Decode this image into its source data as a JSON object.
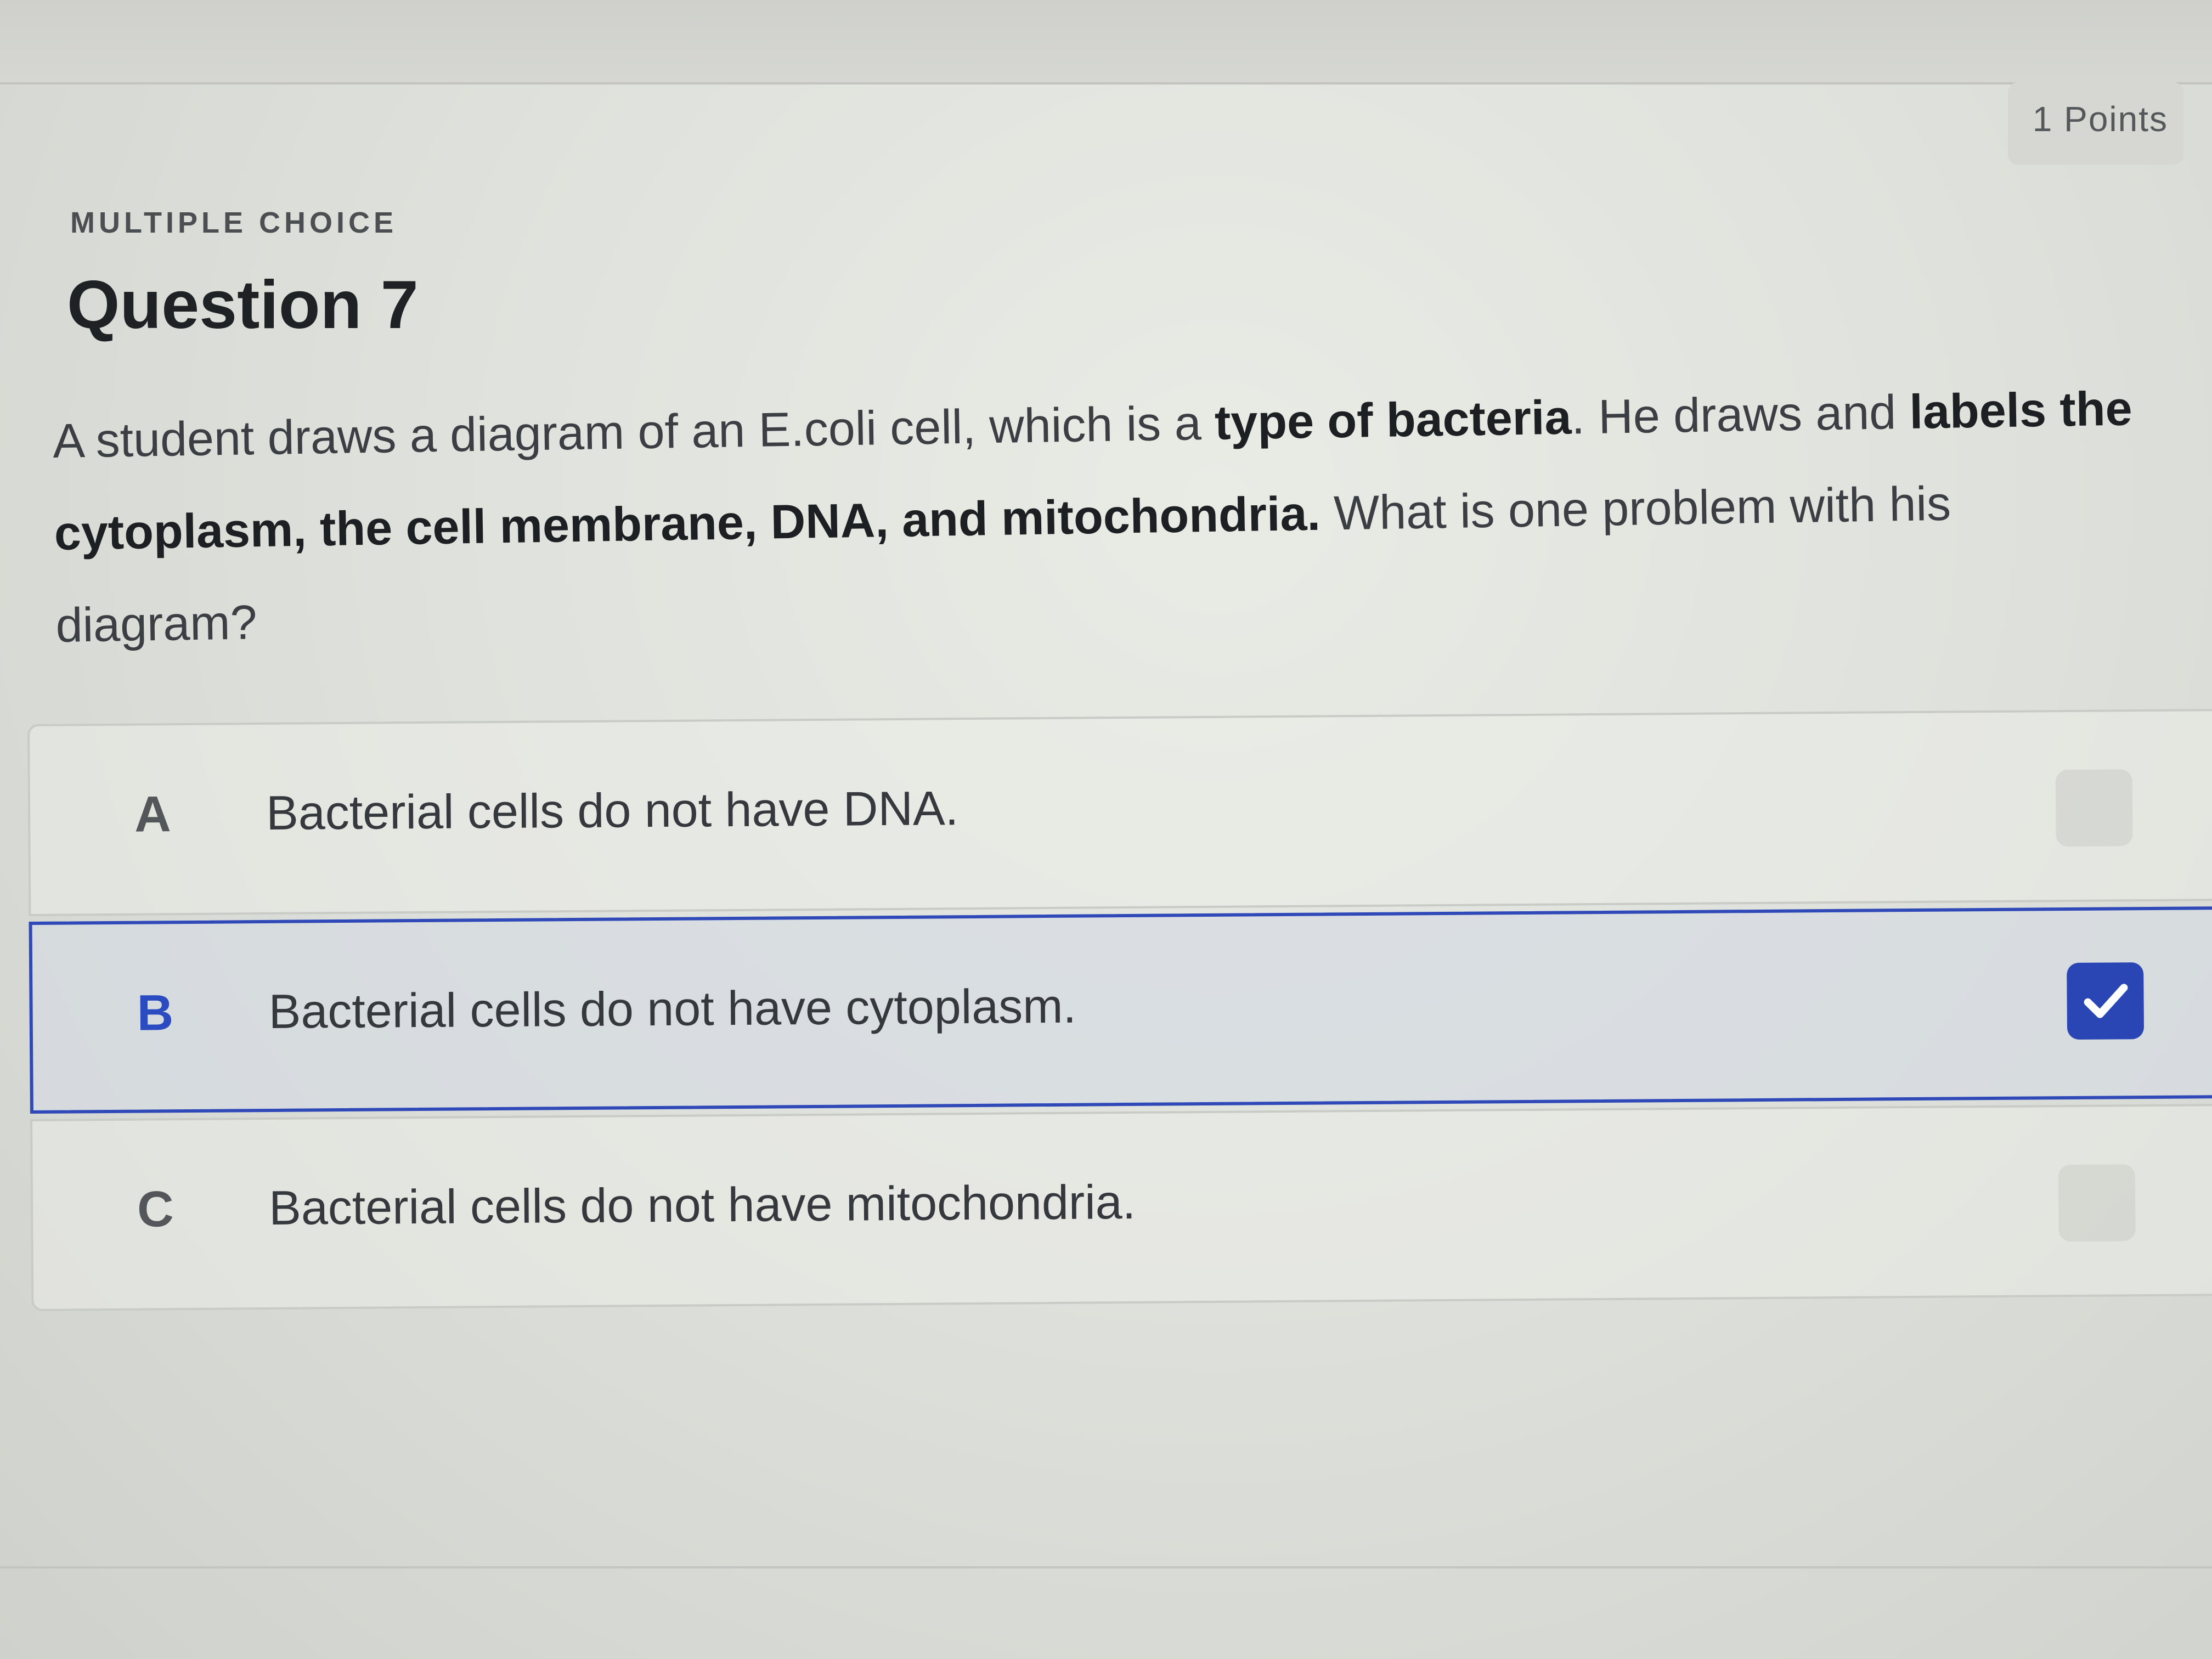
{
  "header": {
    "points": "1 Points"
  },
  "question": {
    "type_label": "MULTIPLE CHOICE",
    "title": "Question 7",
    "text_parts": [
      {
        "text": "A student draws a diagram of an E.coli cell, which is a ",
        "bold": false
      },
      {
        "text": "type of bacteria",
        "bold": true
      },
      {
        "text": ". He draws and ",
        "bold": false
      },
      {
        "text": "labels the cytoplasm, the cell membrane, DNA, and mitochondria.",
        "bold": true
      },
      {
        "text": " What is one problem with his diagram?",
        "bold": false
      }
    ]
  },
  "options": [
    {
      "letter": "A",
      "text": "Bacterial cells do not have DNA.",
      "selected": false
    },
    {
      "letter": "B",
      "text": "Bacterial cells do not have cytoplasm.",
      "selected": true
    },
    {
      "letter": "C",
      "text": "Bacterial cells do not have mitochondria.",
      "selected": false
    }
  ],
  "icons": {
    "selected_check": "checkmark-icon"
  },
  "colors": {
    "accent": "#2a46b4",
    "selected_border": "#2f49b8"
  }
}
